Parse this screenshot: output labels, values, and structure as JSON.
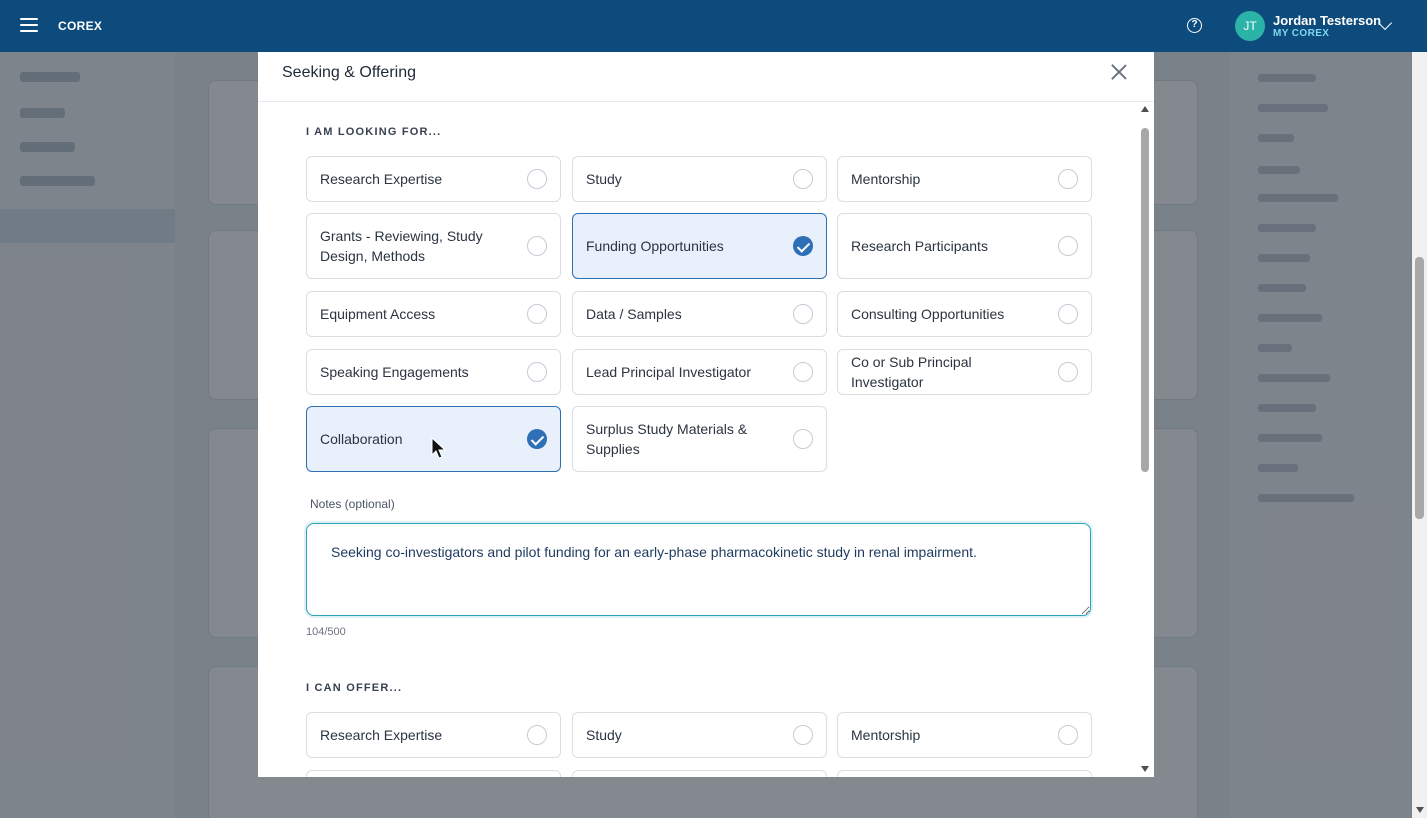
{
  "topbar": {
    "brand": "COREX",
    "user_initials": "JT",
    "user_name": "Jordan Testerson",
    "user_sub": "MY COREX"
  },
  "modal": {
    "title": "Seeking & Offering",
    "seeking": {
      "label": "I AM LOOKING FOR...",
      "options": [
        {
          "label": "Research Expertise",
          "selected": false
        },
        {
          "label": "Study",
          "selected": false
        },
        {
          "label": "Mentorship",
          "selected": false
        },
        {
          "label": "Grants - Reviewing, Study Design, Methods",
          "selected": false
        },
        {
          "label": "Funding Opportunities",
          "selected": true
        },
        {
          "label": "Research Participants",
          "selected": false
        },
        {
          "label": "Equipment Access",
          "selected": false
        },
        {
          "label": "Data / Samples",
          "selected": false
        },
        {
          "label": "Consulting Opportunities",
          "selected": false
        },
        {
          "label": "Speaking Engagements",
          "selected": false
        },
        {
          "label": "Lead Principal Investigator",
          "selected": false
        },
        {
          "label": "Co or Sub Principal Investigator",
          "selected": false
        },
        {
          "label": "Collaboration",
          "selected": true
        },
        {
          "label": "Surplus Study Materials & Supplies",
          "selected": false
        }
      ],
      "notes_label": "Notes (optional)",
      "notes_value": "Seeking co-investigators and pilot funding for an early-phase pharmacokinetic study in renal impairment.",
      "counter": "104/500"
    },
    "offering": {
      "label": "I CAN OFFER...",
      "options": [
        {
          "label": "Research Expertise",
          "selected": false
        },
        {
          "label": "Study",
          "selected": false
        },
        {
          "label": "Mentorship",
          "selected": false
        }
      ]
    }
  },
  "colors": {
    "topbar": "#0e4b7d",
    "selected_fill": "#e8f1fb",
    "selected_accent": "#2f6fb5",
    "focus_ring": "#29a3b8"
  }
}
